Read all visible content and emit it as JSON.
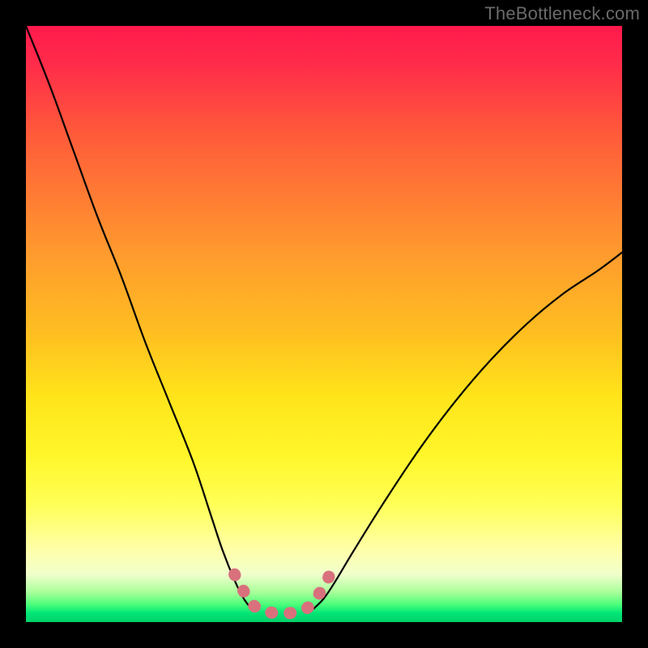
{
  "watermark": {
    "text": "TheBottleneck.com"
  },
  "chart_data": {
    "type": "line",
    "title": "",
    "xlabel": "",
    "ylabel": "",
    "xlim": [
      0,
      100
    ],
    "ylim": [
      0,
      100
    ],
    "grid": false,
    "series": [
      {
        "name": "left-curve",
        "x": [
          0,
          4,
          8,
          12,
          16,
          20,
          24,
          28,
          31,
          33,
          35,
          36.5,
          38
        ],
        "values": [
          100,
          90,
          79,
          68,
          58,
          47,
          37,
          27,
          18,
          12,
          7,
          4,
          2
        ]
      },
      {
        "name": "right-curve",
        "x": [
          48,
          50,
          52,
          55,
          60,
          66,
          72,
          78,
          84,
          90,
          96,
          100
        ],
        "values": [
          2,
          4,
          7,
          12,
          20,
          29,
          37,
          44,
          50,
          55,
          59,
          62
        ]
      },
      {
        "name": "valley-marker",
        "x": [
          35,
          36,
          37,
          38,
          39,
          40,
          42,
          44,
          46,
          47,
          48,
          49,
          50,
          51
        ],
        "values": [
          8,
          6,
          4.5,
          3,
          2.2,
          1.8,
          1.5,
          1.5,
          1.8,
          2.2,
          3.2,
          4.5,
          6,
          8
        ]
      }
    ],
    "colors": {
      "curve": "#000000",
      "marker": "#d9717d",
      "marker_stroke_width": 15,
      "curve_stroke_width": 2.2
    },
    "background_gradient": {
      "top": "#ff1a4d",
      "upper_mid": "#ffb020",
      "mid": "#fff030",
      "lower_mid": "#e8ffb0",
      "bottom": "#00d16a"
    }
  }
}
